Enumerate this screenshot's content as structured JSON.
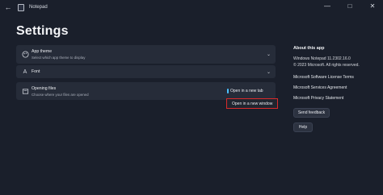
{
  "window": {
    "back_icon": "←",
    "title": "Notepad",
    "controls": [
      "—",
      "□",
      "✕"
    ]
  },
  "page": {
    "title": "Settings"
  },
  "settings": {
    "app_theme": {
      "label": "App theme",
      "description": "Select which app theme to display"
    },
    "font": {
      "label": "Font"
    },
    "opening_files": {
      "label": "Opening files",
      "description": "Choose where your files are opened"
    }
  },
  "dropdown": {
    "options": [
      "Open in a new tab",
      "Open in a new window"
    ],
    "highlighted_option": "Open in a new window"
  },
  "about": {
    "heading": "About this app",
    "version": "Windows Notepad 11.2302.16.0",
    "copyright": "© 2023 Microsoft. All rights reserved.",
    "links": [
      "Microsoft Software License Terms",
      "Microsoft Services Agreement",
      "Microsoft Privacy Statement"
    ],
    "send_feedback": "Send feedback",
    "help": "Help"
  },
  "colors": {
    "background": "#1a1f2b",
    "card": "#262c39",
    "accent": "#4cc2ff",
    "highlight": "#d92b2b"
  }
}
